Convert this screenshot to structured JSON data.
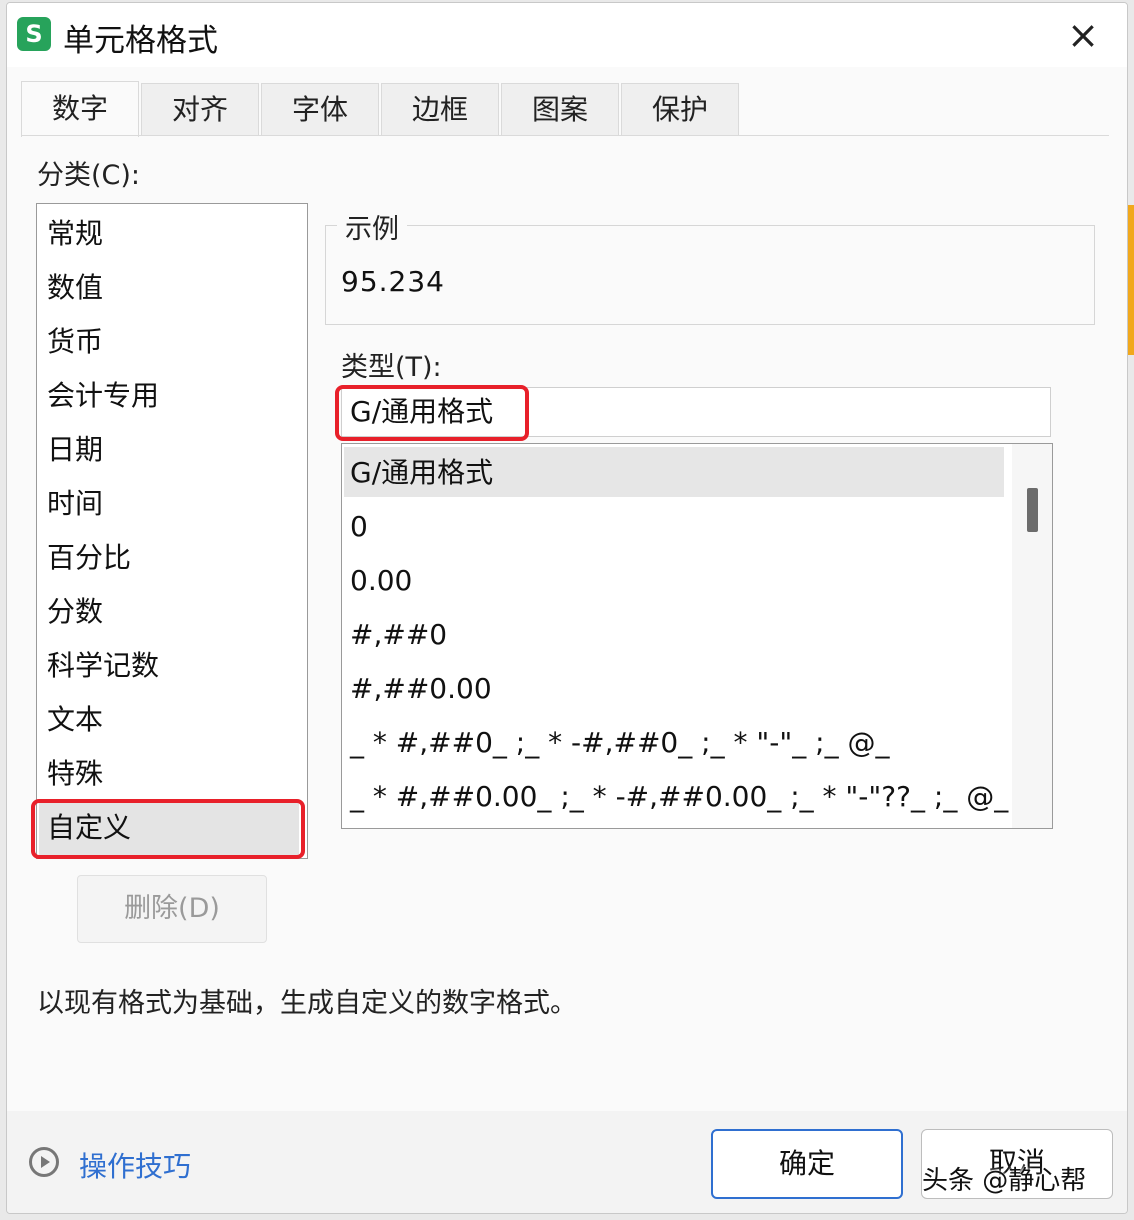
{
  "window": {
    "app_icon": "S",
    "title": "单元格格式",
    "close_icon": "×"
  },
  "tabs": [
    {
      "label": "数字",
      "active": true
    },
    {
      "label": "对齐"
    },
    {
      "label": "字体"
    },
    {
      "label": "边框"
    },
    {
      "label": "图案"
    },
    {
      "label": "保护"
    }
  ],
  "category": {
    "label": "分类(C):",
    "items": [
      "常规",
      "数值",
      "货币",
      "会计专用",
      "日期",
      "时间",
      "百分比",
      "分数",
      "科学记数",
      "文本",
      "特殊",
      "自定义"
    ],
    "selected": "自定义"
  },
  "delete_button": "删除(D)",
  "sample": {
    "legend": "示例",
    "value": "95.234"
  },
  "type": {
    "label": "类型(T):",
    "input_value": "G/通用格式",
    "formats": [
      "G/通用格式",
      "0",
      "0.00",
      "#,##0",
      "#,##0.00",
      "_ * #,##0_ ;_ * -#,##0_ ;_ * \"-\"_ ;_ @_",
      "_ * #,##0.00_ ;_ * -#,##0.00_ ;_ * \"-\"??_ ;_ @_"
    ],
    "selected": "G/通用格式"
  },
  "description": "以现有格式为基础，生成自定义的数字格式。",
  "footer": {
    "tips_icon": "play-circle-icon",
    "tips_label": "操作技巧",
    "ok_label": "确定",
    "cancel_label": "取消"
  },
  "watermark": "头条 @静心帮",
  "colors": {
    "highlight": "#e8202a",
    "link": "#2f6fd0",
    "app_icon": "#27a35b"
  }
}
